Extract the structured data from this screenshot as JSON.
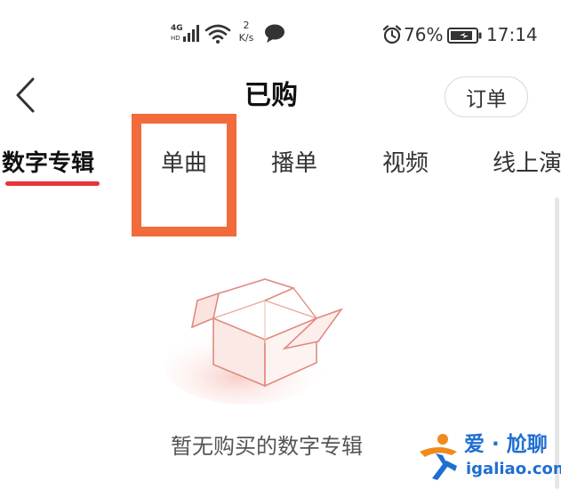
{
  "status_bar": {
    "network_label": "4G",
    "network_sub": "HD",
    "speed_value": "2",
    "speed_unit": "K/s",
    "battery_percent": "76%",
    "time": "17:14",
    "icons": [
      "signal-icon",
      "wifi-icon",
      "chat-bubble-icon",
      "alarm-icon",
      "battery-icon"
    ]
  },
  "header": {
    "title": "已购",
    "orders_label": "订单",
    "back_icon": "chevron-left-icon"
  },
  "tabs": [
    {
      "label": "数字专辑",
      "active": true
    },
    {
      "label": "单曲",
      "active": false
    },
    {
      "label": "播单",
      "active": false
    },
    {
      "label": "视频",
      "active": false
    },
    {
      "label": "线上演",
      "active": false
    }
  ],
  "empty_state": {
    "icon": "open-box-icon",
    "message": "暂无购买的数字专辑"
  },
  "watermark": {
    "text_cn": "爱 · 尬聊",
    "url": "igaliao.com"
  },
  "colors": {
    "accent": "#e8333a",
    "highlight": "#f26b3a",
    "box_outline": "#e08a80",
    "watermark_blue": "#1f6fd1",
    "watermark_orange": "#f08a1c"
  }
}
